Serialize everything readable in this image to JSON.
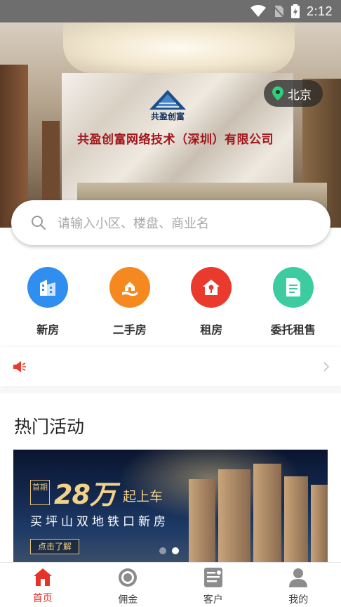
{
  "status_bar": {
    "time": "2:12"
  },
  "hero": {
    "logo_text": "共盈创富",
    "company_name": "共盈创富网络技术（深圳）有限公司",
    "city": "北京"
  },
  "search": {
    "placeholder": "请输入小区、楼盘、商业名"
  },
  "categories": [
    {
      "label": "新房",
      "icon": "building-icon",
      "color": "#2f8ef0"
    },
    {
      "label": "二手房",
      "icon": "house-hand-icon",
      "color": "#f5891f"
    },
    {
      "label": "租房",
      "icon": "house-key-icon",
      "color": "#ea3a2d"
    },
    {
      "label": "委托租售",
      "icon": "document-icon",
      "color": "#3ccca0"
    }
  ],
  "notice": {
    "icon": "megaphone-icon",
    "text": ""
  },
  "hot_section": {
    "title": "热门活动",
    "banner": {
      "tag": "首期",
      "headline": "28万",
      "headline_suffix": "起上车",
      "subtitle": "买坪山双地铁口新房",
      "button": "点击了解",
      "slides": 2,
      "active_slide": 2
    }
  },
  "tabbar": [
    {
      "label": "首页",
      "icon": "home-icon",
      "active": true
    },
    {
      "label": "佣金",
      "icon": "coin-icon",
      "active": false
    },
    {
      "label": "客户",
      "icon": "customer-card-icon",
      "active": false
    },
    {
      "label": "我的",
      "icon": "user-icon",
      "active": false
    }
  ],
  "colors": {
    "accent": "#e5332a",
    "status_bar": "#6e6e6e"
  }
}
